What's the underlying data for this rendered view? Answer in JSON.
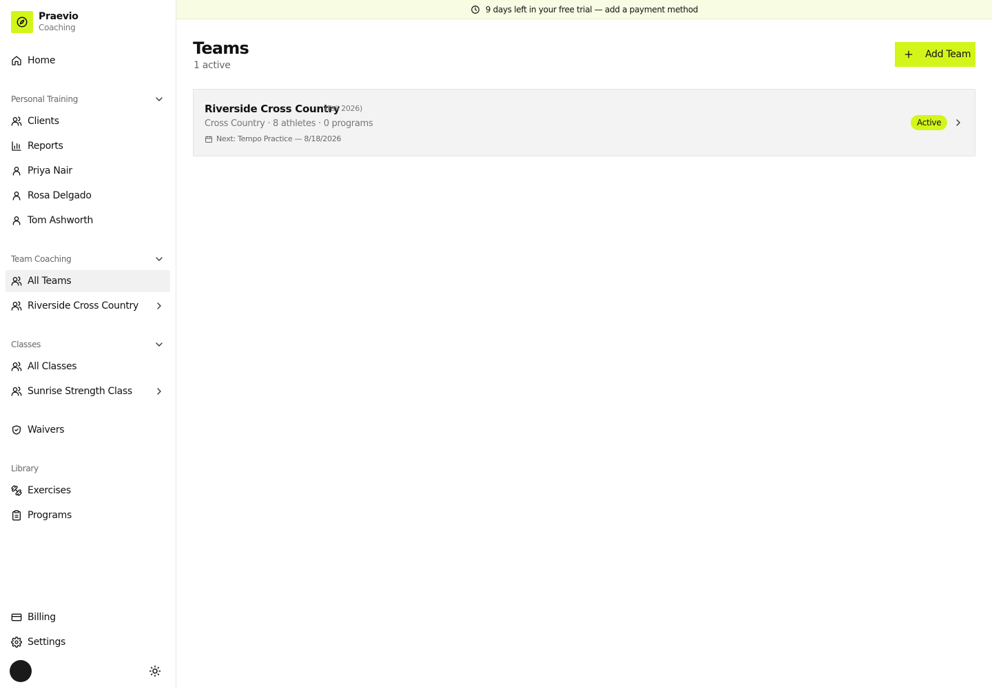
{
  "brand": {
    "name": "Praevio",
    "subtitle": "Coaching",
    "accent_color": "#d4f51a"
  },
  "banner": {
    "text": "9 days left in your free trial — add a payment method",
    "icon": "clock-icon"
  },
  "sidebar": {
    "home": {
      "label": "Home",
      "icon": "home-icon"
    },
    "personal_training": {
      "title": "Personal Training",
      "items": [
        {
          "label": "Clients",
          "icon": "users-icon"
        },
        {
          "label": "Reports",
          "icon": "bar-chart-icon"
        },
        {
          "label": "Priya Nair",
          "icon": "user-icon"
        },
        {
          "label": "Rosa Delgado",
          "icon": "user-icon"
        },
        {
          "label": "Tom Ashworth",
          "icon": "user-icon"
        }
      ]
    },
    "team_coaching": {
      "title": "Team Coaching",
      "items": [
        {
          "label": "All Teams",
          "icon": "users-icon",
          "active": true
        },
        {
          "label": "Riverside Cross Country",
          "icon": "users-icon"
        }
      ]
    },
    "classes": {
      "title": "Classes",
      "items": [
        {
          "label": "All Classes",
          "icon": "users-icon"
        },
        {
          "label": "Sunrise Strength Class",
          "icon": "users-icon"
        }
      ]
    },
    "waivers": {
      "label": "Waivers",
      "icon": "shield-check-icon"
    },
    "library": {
      "title": "Library",
      "items": [
        {
          "label": "Exercises",
          "icon": "dumbbell-icon"
        },
        {
          "label": "Programs",
          "icon": "clipboard-icon"
        }
      ]
    },
    "billing": {
      "label": "Billing",
      "icon": "credit-card-icon"
    },
    "settings": {
      "label": "Settings",
      "icon": "gear-icon"
    }
  },
  "main": {
    "title": "Teams",
    "subtitle": "1 active",
    "add_button": "Add Team",
    "teams": [
      {
        "name": "Riverside Cross Country",
        "season": "(Fall 2026)",
        "meta": "Cross Country · 8 athletes · 0 programs",
        "next": "Next: Tempo Practice — 8/18/2026",
        "status": "Active"
      }
    ]
  }
}
